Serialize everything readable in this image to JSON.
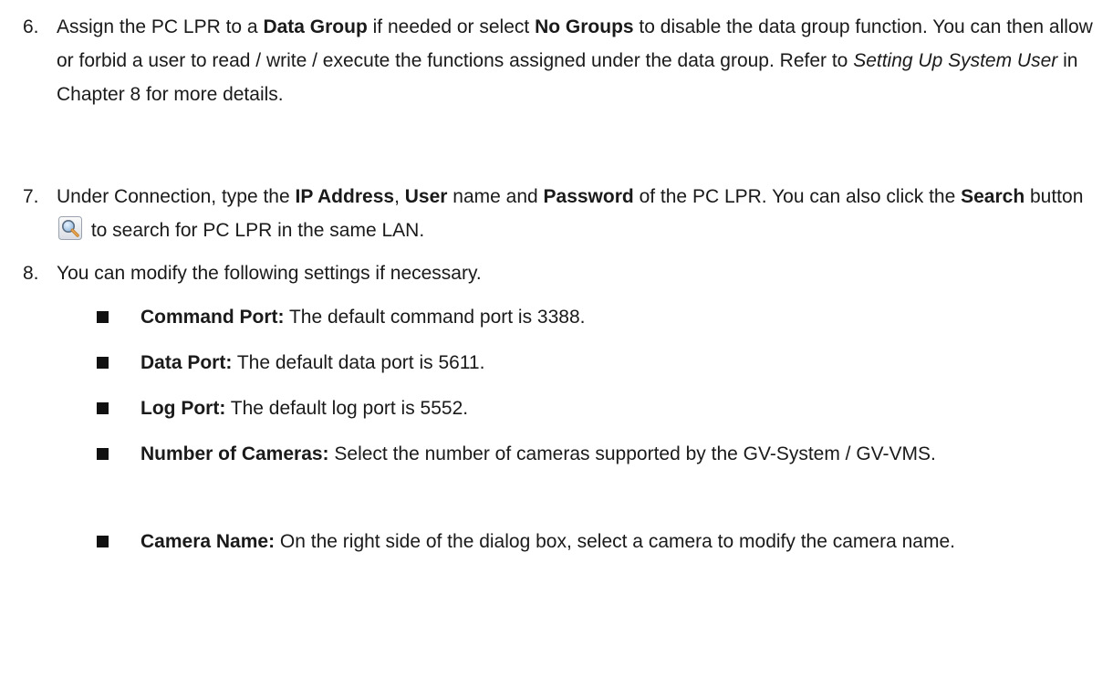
{
  "step6": {
    "num": "6.",
    "t1": "Assign the PC LPR to a ",
    "b1": "Data Group",
    "t2": " if needed or select ",
    "b2": "No Groups",
    "t3": " to disable the data group function. You can then allow or forbid a user to read / write / execute the functions assigned under the data group. Refer to ",
    "i1": "Setting Up System User",
    "t4": " in Chapter 8 for more details."
  },
  "step7": {
    "num": "7.",
    "t1": "Under Connection, type the ",
    "b1": "IP Address",
    "t2": ", ",
    "b2": "User",
    "t3": " name and ",
    "b3": "Password",
    "t4": " of the PC LPR. You can also click the ",
    "b4": "Search",
    "t5": " button ",
    "icon": "search-magnifier-icon",
    "t6": " to search for PC LPR in the same LAN."
  },
  "step8": {
    "num": "8.",
    "text": "You can modify the following settings if necessary."
  },
  "bullets": [
    {
      "label": "Command Port:",
      "text": " The default command port is 3388."
    },
    {
      "label": "Data Port:",
      "text": " The default data port is 5611."
    },
    {
      "label": "Log Port:",
      "text": " The default log port is 5552."
    },
    {
      "label": "Number of Cameras:",
      "text": " Select the number of cameras supported by the GV-System / GV-VMS."
    },
    {
      "label": "Camera Name:",
      "text": " On the right side of the dialog box, select a camera to modify the camera name."
    }
  ]
}
